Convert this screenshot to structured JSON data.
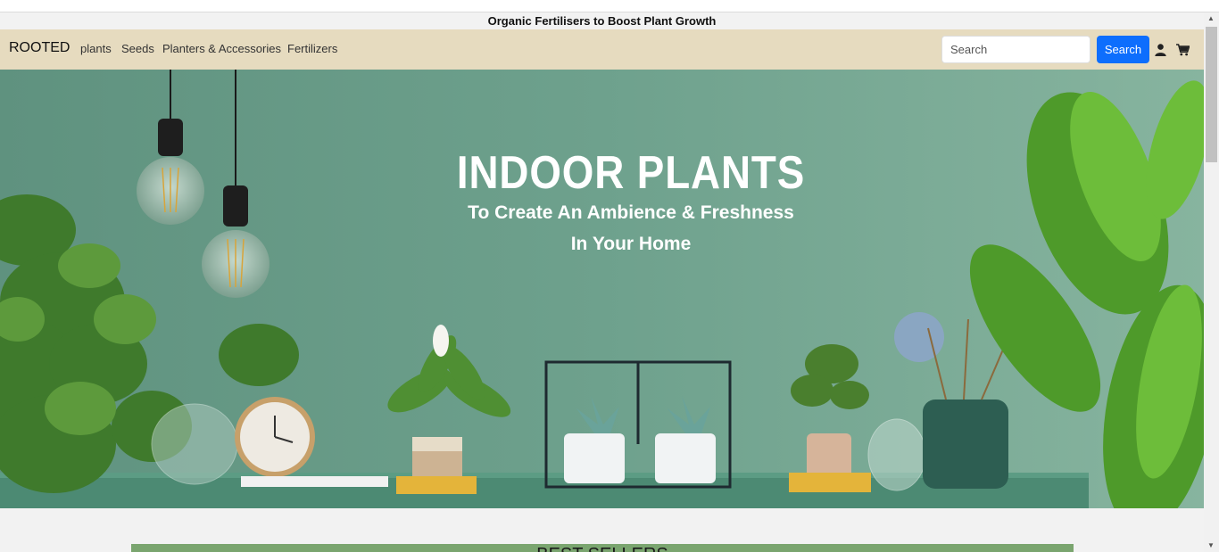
{
  "announcement": "Organic Fertilisers to Boost Plant Growth",
  "nav": {
    "brand": "ROOTED",
    "links": [
      "plants",
      "Seeds",
      "Planters & Accessories",
      "Fertilizers"
    ],
    "search_placeholder": "Search",
    "search_button": "Search",
    "icons": [
      "user-icon",
      "cart-icon"
    ]
  },
  "hero": {
    "title": "INDOOR PLANTS",
    "subtitle_line1": "To Create An Ambience & Freshness",
    "subtitle_line2": "In Your Home"
  },
  "section": {
    "title": "BEST SELLERS"
  },
  "colors": {
    "navbar": "#e6dbbf",
    "accent": "#0d6efd",
    "hero_bg": "#6b9e8a",
    "section_band": "#7aa56f"
  }
}
